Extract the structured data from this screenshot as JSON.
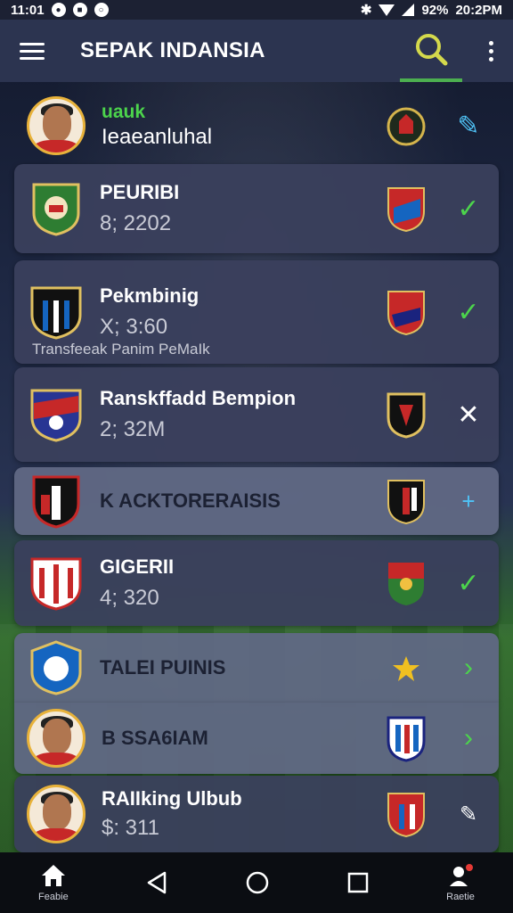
{
  "status_bar": {
    "time": "11:01",
    "battery": "92%",
    "right_time": "20:2PM"
  },
  "app_bar": {
    "title": "SEPAK INDANSIA"
  },
  "items": [
    {
      "name": "uauk",
      "value": "Ieaeanluhal",
      "action": "check-edit"
    },
    {
      "name": "PEURIBI",
      "value": "8; 2202",
      "action": "check"
    },
    {
      "name": "Pekmbinig",
      "value": "X; 3:60",
      "note": "Transfeeak Panim PeMaIk",
      "action": "check"
    },
    {
      "name": "Ranskffadd Bempion",
      "value": "2; 32M",
      "action": "close"
    },
    {
      "name": "K ACKTORERAISIS",
      "value": "",
      "action": "plus"
    },
    {
      "name": "GIGERII",
      "value": "4; 320",
      "action": "check"
    },
    {
      "name": "TALEI PUINIS",
      "value": "",
      "action": "chevron"
    },
    {
      "name": "B SSA6IAM",
      "prefix": "B",
      "value": "",
      "action": "chevron"
    },
    {
      "name": "RAIIking Ulbub",
      "value": "$: 311",
      "action": "edit"
    }
  ],
  "bottom_nav": {
    "home_label": "Feabie",
    "profile_label": "Raetie"
  },
  "colors": {
    "accent": "#4cd44c",
    "header": "#2c3450",
    "card": "#3a405c"
  }
}
